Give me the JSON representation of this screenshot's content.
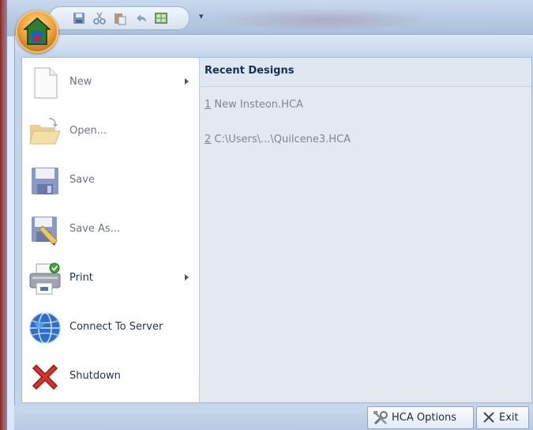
{
  "quick_access_toolbar": {
    "icons": [
      "save-icon",
      "cut-icon",
      "paste-icon",
      "undo-icon",
      "grid-icon"
    ],
    "dropdown_glyph": "▾"
  },
  "menu": {
    "items": [
      {
        "label": "New",
        "icon": "new-document-icon",
        "enabled": false,
        "submenu": true
      },
      {
        "label": "Open...",
        "icon": "open-folder-icon",
        "enabled": false,
        "submenu": false
      },
      {
        "label": "Save",
        "icon": "floppy-disk-icon",
        "enabled": false,
        "submenu": false
      },
      {
        "label": "Save As...",
        "icon": "save-as-icon",
        "enabled": false,
        "submenu": false
      },
      {
        "label": "Print",
        "icon": "printer-icon",
        "enabled": true,
        "submenu": true
      },
      {
        "label": "Connect To Server",
        "icon": "globe-icon",
        "enabled": true,
        "submenu": false
      },
      {
        "label": "Shutdown",
        "icon": "red-x-icon",
        "enabled": true,
        "submenu": false
      }
    ]
  },
  "recent": {
    "title": "Recent Designs",
    "items": [
      {
        "number": "1",
        "name": " New Insteon.HCA"
      },
      {
        "number": "2",
        "name": " C:\\Users\\...\\Quilcene3.HCA"
      }
    ]
  },
  "footer": {
    "options_label": "HCA Options",
    "exit_label": "Exit"
  },
  "colors": {
    "accent_orange": "#f0a33a",
    "menu_blue": "#c3d4eb",
    "shutdown_red": "#d8322a"
  }
}
